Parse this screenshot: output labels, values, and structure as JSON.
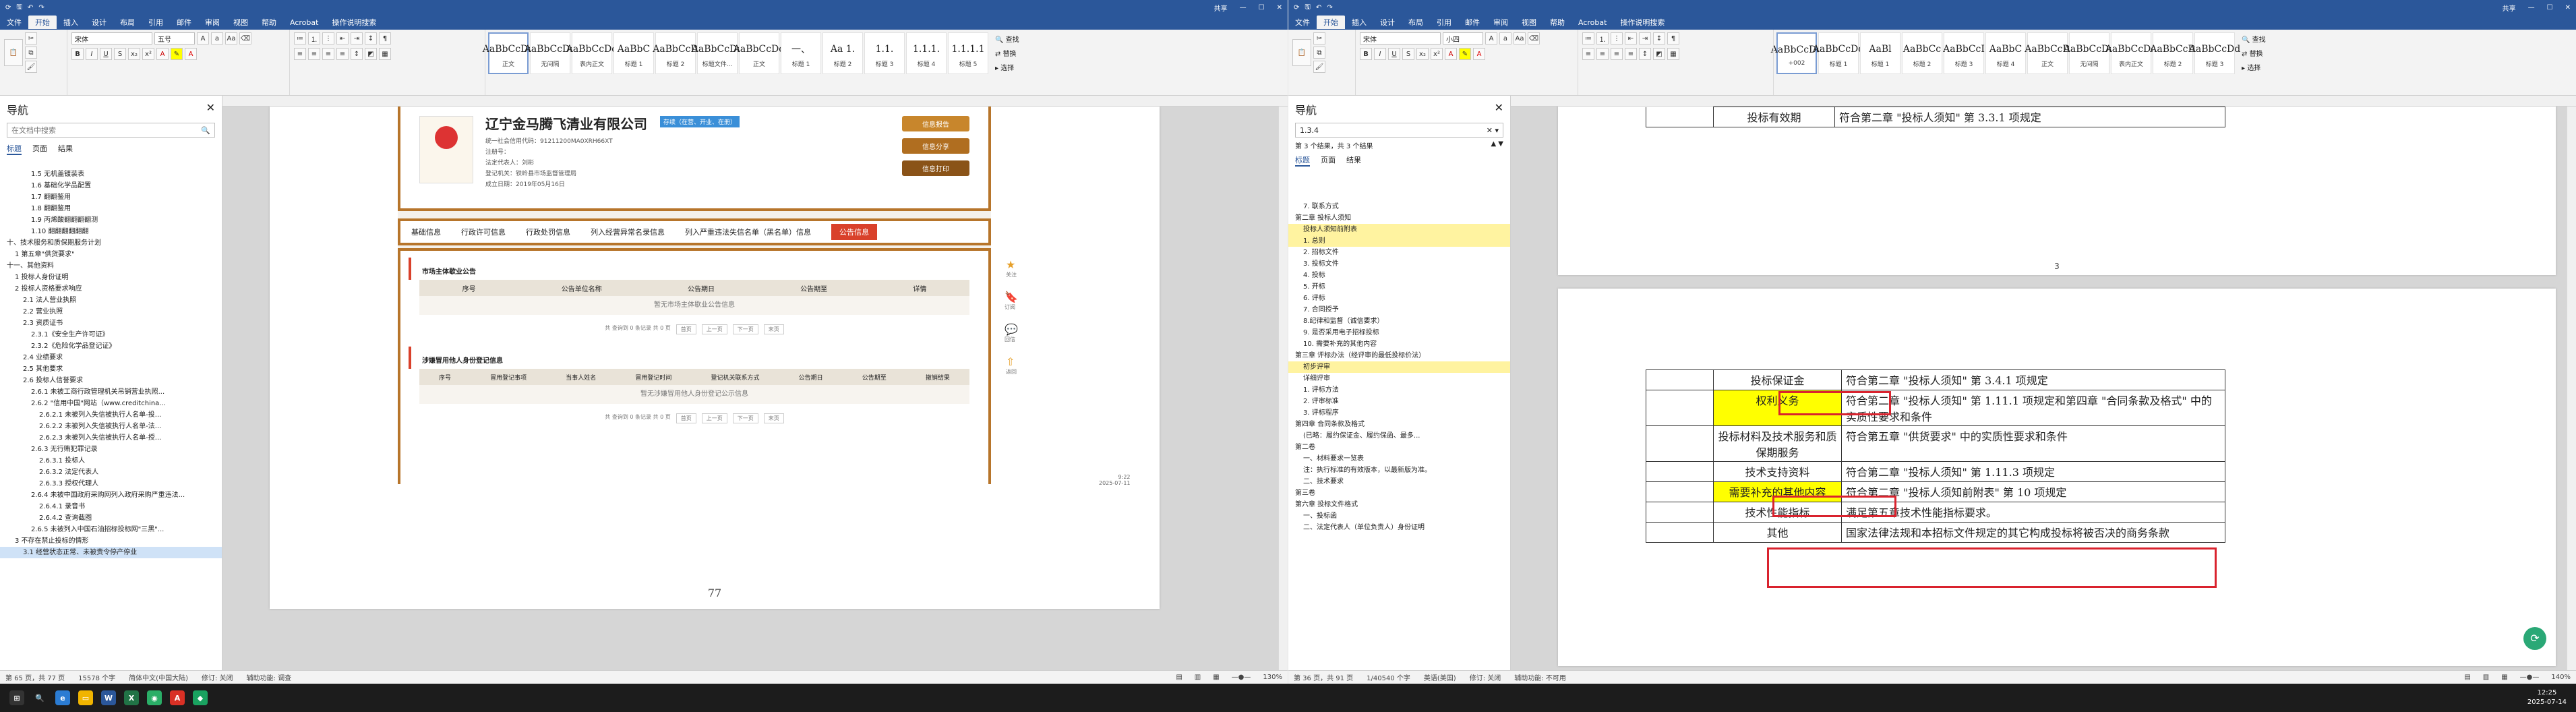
{
  "left_window": {
    "title": "",
    "share": "共享",
    "tabs": [
      "文件",
      "开始",
      "插入",
      "设计",
      "布局",
      "引用",
      "邮件",
      "审阅",
      "视图",
      "帮助",
      "Acrobat",
      "操作说明搜索"
    ],
    "font_name": "宋体",
    "font_size": "五号",
    "styles": [
      {
        "preview": "AaBbCcDd",
        "name": "正文"
      },
      {
        "preview": "AaBbCcDd",
        "name": "无间隔"
      },
      {
        "preview": "AaBbCcDd",
        "name": "表内正文"
      },
      {
        "preview": "AaBbC",
        "name": "标题 1"
      },
      {
        "preview": "AaBbCcD",
        "name": "标题 2"
      },
      {
        "preview": "AaBbCcDd",
        "name": "标题文件..."
      },
      {
        "preview": "AaBbCcDd",
        "name": "正文"
      },
      {
        "preview": "一、",
        "name": "标题 1"
      },
      {
        "preview": "Aa 1.",
        "name": "标题 2"
      },
      {
        "preview": "1.1.",
        "name": "标题 3"
      },
      {
        "preview": "1.1.1.",
        "name": "标题 4"
      },
      {
        "preview": "1.1.1.1",
        "name": "标题 5"
      }
    ],
    "editing": [
      "查找",
      "替换",
      "选择"
    ],
    "nav": {
      "header": "导航",
      "search_placeholder": "在文档中搜索",
      "tabs": [
        "标题",
        "页面",
        "结果"
      ],
      "items": [
        {
          "t": "1.5 无机盖镀装表",
          "i": 3
        },
        {
          "t": "1.6 基础化学品配置",
          "i": 3
        },
        {
          "t": "1.7 翻翻鉴用",
          "i": 3
        },
        {
          "t": "1.8 翻翻鉴用",
          "i": 3
        },
        {
          "t": "1.9 丙烯酸翻翻翻翻测",
          "i": 3
        },
        {
          "t": "1.10 翻翻翻翻翻翻",
          "i": 3
        },
        {
          "t": "十、技术服务和质保期服务计划",
          "i": 0
        },
        {
          "t": "1 第五章\"供货要求\"",
          "i": 1
        },
        {
          "t": "十一、其他资料",
          "i": 0
        },
        {
          "t": "1 投标人身份证明",
          "i": 1
        },
        {
          "t": "2 投标人资格要求响应",
          "i": 1
        },
        {
          "t": "2.1 法人营业执照",
          "i": 2
        },
        {
          "t": "2.2 营业执照",
          "i": 2
        },
        {
          "t": "2.3 资质证书",
          "i": 2
        },
        {
          "t": "2.3.1《安全生产许可证》",
          "i": 3
        },
        {
          "t": "2.3.2《危险化学品登记证》",
          "i": 3
        },
        {
          "t": "2.4 业绩要求",
          "i": 2
        },
        {
          "t": "2.5 其他要求",
          "i": 2
        },
        {
          "t": "2.6 投标人信誉要求",
          "i": 2
        },
        {
          "t": "2.6.1 未被工商行政管理机关吊销营业执照...",
          "i": 3
        },
        {
          "t": "2.6.2 \"信用中国\"网站（www.creditchina...",
          "i": 3
        },
        {
          "t": "2.6.2.1 未被列入失信被执行人名单-投...",
          "i": 4
        },
        {
          "t": "2.6.2.2 未被列入失信被执行人名单-法...",
          "i": 4
        },
        {
          "t": "2.6.2.3 未被列入失信被执行人名单-授...",
          "i": 4
        },
        {
          "t": "2.6.3 无行贿犯罪记录",
          "i": 3
        },
        {
          "t": "2.6.3.1 投标人",
          "i": 4
        },
        {
          "t": "2.6.3.2 法定代表人",
          "i": 4
        },
        {
          "t": "2.6.3.3 授权代理人",
          "i": 4
        },
        {
          "t": "2.6.4 未被中国政府采购网列入政府采购严重违法...",
          "i": 3
        },
        {
          "t": "2.6.4.1 录音书",
          "i": 4
        },
        {
          "t": "2.6.4.2 查询截图",
          "i": 4
        },
        {
          "t": "2.6.5 未被列入中国石油招标投标网\"三黑\"...",
          "i": 3
        },
        {
          "t": "3 不存在禁止投标的情形",
          "i": 1
        },
        {
          "t": "3.1 经营状态正常、未被责令停产停业",
          "i": 2,
          "sel": true
        }
      ]
    },
    "company": {
      "name": "辽宁金马腾飞清业有限公司",
      "tag": "存续（在营、开业、在册）",
      "fields": [
        [
          "统一社会信用代码",
          "91211200MA0XRH66XT"
        ],
        [
          "注册号",
          ""
        ],
        [
          "法定代表人",
          "刘彬"
        ],
        [
          "登记机关",
          "铁岭县市场监督管理局"
        ],
        [
          "成立日期",
          "2019年05月16日"
        ]
      ],
      "buttons": [
        "信息报告",
        "信息分享",
        "信息打印"
      ],
      "tabs": [
        "基础信息",
        "行政许可信息",
        "行政处罚信息",
        "列入经营异常名录信息",
        "列入严重违法失信名单（黑名单）信息",
        "公告信息"
      ],
      "sec1": "市场主体歇业公告",
      "sec1_cols": [
        "序号",
        "公告单位名称",
        "公告期日",
        "公告期至",
        "详情"
      ],
      "sec1_empty": "暂无市场主体歇业公告信息",
      "sec2": "涉嫌冒用他人身份登记信息",
      "sec2_cols": [
        "序号",
        "冒用登记事项",
        "当事人姓名",
        "冒用登记时间",
        "登记机关联系方式",
        "公告期日",
        "公告期至",
        "撤销结果"
      ],
      "sec2_empty": "暂无涉嫌冒用他人身份登记公示信息",
      "pager": [
        "首页",
        "上一页",
        "下一页",
        "末页"
      ],
      "pager_text": "共 查询到 0 条记录 共 0 页",
      "side": [
        "关注",
        "订阅",
        "回信",
        "返回"
      ],
      "footer_time": "9:22",
      "footer_date": "2025-07-11"
    },
    "page_number": "77",
    "status": [
      "第 65 页，共 77 页",
      "15578 个字",
      "简体中文(中国大陆)",
      "修订: 关闭",
      "辅助功能: 调查"
    ],
    "zoom": "130%"
  },
  "right_window": {
    "title": "",
    "share": "共享",
    "font_name": "宋体",
    "font_size": "小四",
    "styles": [
      {
        "preview": "AaBbCcDd",
        "name": "+002"
      },
      {
        "preview": "AaBbCcDd",
        "name": "标题 1"
      },
      {
        "preview": "AaBl",
        "name": "标题 1"
      },
      {
        "preview": "AaBbCc",
        "name": "标题 2"
      },
      {
        "preview": "AaBbCcI",
        "name": "标题 3"
      },
      {
        "preview": "AaBbC",
        "name": "标题 4"
      },
      {
        "preview": "AaBbCcD",
        "name": "正文"
      },
      {
        "preview": "AaBbCcDd",
        "name": "无间隔"
      },
      {
        "preview": "AaBbCcDd",
        "name": "表内正文"
      },
      {
        "preview": "AaBbCcD",
        "name": "标题 2"
      },
      {
        "preview": "AaBbCcDd",
        "name": "标题 3"
      }
    ],
    "nav": {
      "header": "导航",
      "search_value": "1.3.4",
      "result": "第 3 个结果，共 3 个结果",
      "tabs": [
        "标题",
        "页面",
        "结果"
      ],
      "items": [
        {
          "t": "7. 联系方式",
          "i": 1
        },
        {
          "t": "第二章 投标人须知",
          "i": 0
        },
        {
          "t": "投标人须知前附表",
          "i": 1,
          "hl": true
        },
        {
          "t": "1. 总则",
          "i": 1,
          "hl": true
        },
        {
          "t": "2. 招标文件",
          "i": 1
        },
        {
          "t": "3. 投标文件",
          "i": 1
        },
        {
          "t": "4. 投标",
          "i": 1
        },
        {
          "t": "5. 开标",
          "i": 1
        },
        {
          "t": "6. 评标",
          "i": 1
        },
        {
          "t": "7. 合同授予",
          "i": 1
        },
        {
          "t": "8.纪律和监督（诚信要求）",
          "i": 1
        },
        {
          "t": "9. 是否采用电子招标投标",
          "i": 1
        },
        {
          "t": "10. 需要补充的其他内容",
          "i": 1
        },
        {
          "t": "第三章 评标办法（经评审的最低投标价法）",
          "i": 0
        },
        {
          "t": "初步评审",
          "i": 1,
          "hl": true
        },
        {
          "t": "详细评审",
          "i": 1
        },
        {
          "t": "1. 评标方法",
          "i": 1
        },
        {
          "t": "2. 评审标准",
          "i": 1
        },
        {
          "t": "3. 评标程序",
          "i": 1
        },
        {
          "t": "第四章 合同条款及格式",
          "i": 0
        },
        {
          "t": "(已略：履约保证金、履约保函、最多...",
          "i": 1
        },
        {
          "t": "",
          "i": 0
        },
        {
          "t": "第二卷",
          "i": 0
        },
        {
          "t": "一、材料要求一览表",
          "i": 1
        },
        {
          "t": "注：执行标准的有效版本，以最新版为准。",
          "i": 1
        },
        {
          "t": "二、技术要求",
          "i": 1
        },
        {
          "t": "",
          "i": 0
        },
        {
          "t": "第三卷",
          "i": 0
        },
        {
          "t": "第六章 投标文件格式",
          "i": 0
        },
        {
          "t": "一、投标函",
          "i": 1
        },
        {
          "t": "",
          "i": 0
        },
        {
          "t": "二、法定代表人（单位负责人）身份证明",
          "i": 1
        }
      ]
    },
    "table_top": [
      {
        "c": "投标有效期",
        "d": "符合第二章 \"投标人须知\" 第 3.3.1 项规定"
      }
    ],
    "table": [
      {
        "c": "投标保证金",
        "d": "符合第二章 \"投标人须知\" 第 3.4.1 项规定"
      },
      {
        "c": "权利义务",
        "d": "符合第二章 \"投标人须知\" 第 1.11.1 项规定和第四章 \"合同条款及格式\" 中的实质性要求和条件"
      },
      {
        "c": "投标材料及技术服务和质保期服务",
        "d": "符合第五章 \"供货要求\" 中的实质性要求和条件"
      },
      {
        "c": "技术支持资料",
        "d": "符合第二章 \"投标人须知\" 第 1.11.3 项规定"
      },
      {
        "c": "需要补充的其他内容",
        "d": "符合第二章 \"投标人须知前附表\" 第 10 项规定"
      },
      {
        "c": "技术性能指标",
        "d": "满足第五章技术性能指标要求。"
      },
      {
        "c": "其他",
        "d": "国家法律法规和本招标文件规定的其它构成投标将被否决的商务条款"
      }
    ],
    "page_num": "3",
    "status": [
      "第 36 页，共 91 页",
      "1/40540 个字",
      "英语(美国)",
      "修订: 关闭",
      "辅助功能: 不可用"
    ],
    "zoom": "140%"
  },
  "taskbar": {
    "time": "12:25",
    "date": "2025-07-14"
  }
}
